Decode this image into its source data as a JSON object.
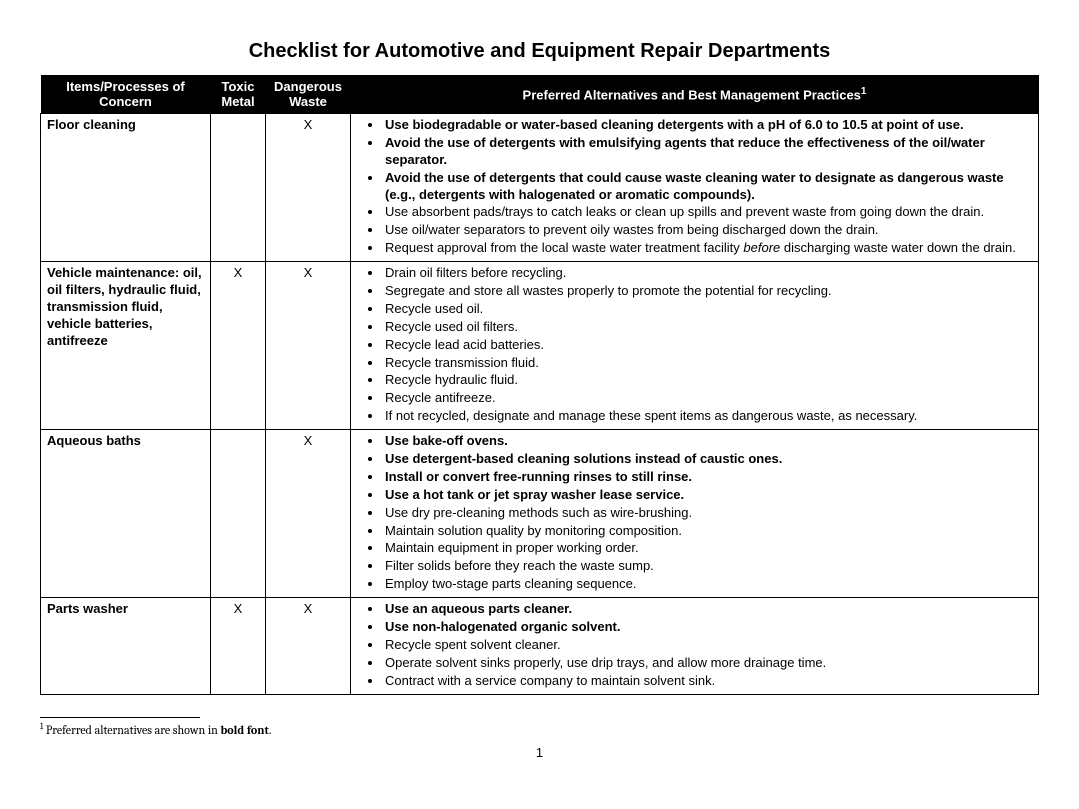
{
  "title": "Checklist for Automotive and Equipment Repair Departments",
  "headers": {
    "item": "Items/Processes of Concern",
    "toxic": "Toxic Metal",
    "dangerous": "Dangerous Waste",
    "preferred": "Preferred Alternatives and Best Management Practices",
    "preferred_sup": "1"
  },
  "rows": [
    {
      "item": "Floor cleaning",
      "toxic": "",
      "dangerous": "X",
      "bullets": [
        {
          "bold": true,
          "text": "Use biodegradable or water-based cleaning detergents with a pH of 6.0 to 10.5 at point of use."
        },
        {
          "bold": true,
          "text": "Avoid the use of detergents with emulsifying agents that reduce the effectiveness of the oil/water separator."
        },
        {
          "bold": true,
          "text": "Avoid the use of detergents that could cause waste cleaning water to designate as dangerous waste (e.g., detergents with halogenated or aromatic compounds)."
        },
        {
          "bold": false,
          "text": "Use absorbent pads/trays to catch leaks or clean up spills and prevent waste from going down the drain."
        },
        {
          "bold": false,
          "text": "Use oil/water separators to prevent oily wastes from being discharged down the drain."
        },
        {
          "bold": false,
          "text_before_italic": "Request approval from the local waste water treatment facility ",
          "italic": "before",
          "text_after_italic": " discharging waste water down the drain."
        }
      ]
    },
    {
      "item": "Vehicle maintenance: oil, oil filters, hydraulic fluid, transmission fluid, vehicle batteries, antifreeze",
      "toxic": "X",
      "dangerous": "X",
      "bullets": [
        {
          "bold": false,
          "text": "Drain oil filters before recycling."
        },
        {
          "bold": false,
          "text": "Segregate and store all wastes properly to promote the potential for recycling."
        },
        {
          "bold": false,
          "text": "Recycle used oil."
        },
        {
          "bold": false,
          "text": "Recycle used oil filters."
        },
        {
          "bold": false,
          "text": "Recycle lead acid batteries."
        },
        {
          "bold": false,
          "text": "Recycle transmission fluid."
        },
        {
          "bold": false,
          "text": "Recycle hydraulic fluid."
        },
        {
          "bold": false,
          "text": "Recycle antifreeze."
        },
        {
          "bold": false,
          "text": "If not recycled, designate and manage these spent items as dangerous waste, as necessary."
        }
      ]
    },
    {
      "item": "Aqueous baths",
      "toxic": "",
      "dangerous": "X",
      "bullets": [
        {
          "bold": true,
          "text": "Use bake-off ovens."
        },
        {
          "bold": true,
          "text": "Use detergent-based cleaning solutions instead of caustic ones."
        },
        {
          "bold": true,
          "text": "Install or convert free-running rinses to still rinse."
        },
        {
          "bold": true,
          "text": "Use a hot tank or jet spray washer lease service."
        },
        {
          "bold": false,
          "text": "Use dry pre-cleaning methods such as wire-brushing."
        },
        {
          "bold": false,
          "text": "Maintain solution quality by monitoring composition."
        },
        {
          "bold": false,
          "text": "Maintain equipment in proper working order."
        },
        {
          "bold": false,
          "text": "Filter solids before they reach the waste sump."
        },
        {
          "bold": false,
          "text": "Employ two-stage parts cleaning sequence."
        }
      ]
    },
    {
      "item": "Parts washer",
      "toxic": "X",
      "dangerous": "X",
      "bullets": [
        {
          "bold": true,
          "text": "Use an aqueous parts cleaner."
        },
        {
          "bold": true,
          "text": "Use non-halogenated organic solvent."
        },
        {
          "bold": false,
          "text": "Recycle spent solvent cleaner."
        },
        {
          "bold": false,
          "text": "Operate solvent sinks properly, use drip trays, and allow more drainage time."
        },
        {
          "bold": false,
          "text": "Contract with a service company to maintain solvent sink."
        }
      ]
    }
  ],
  "footnote": {
    "sup": "1",
    "text_before_bold": " Preferred alternatives are shown in ",
    "bold": "bold font",
    "text_after_bold": "."
  },
  "page_number": "1"
}
